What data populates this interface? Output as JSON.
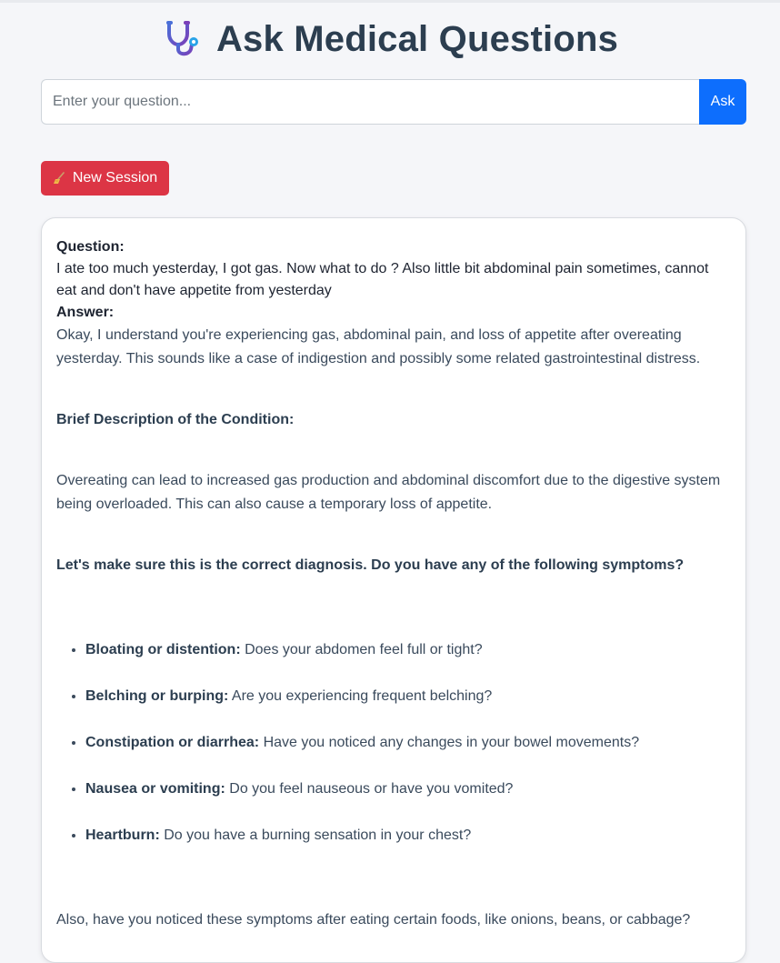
{
  "header": {
    "title": "Ask Medical Questions",
    "logo_icon": "stethoscope-icon"
  },
  "search": {
    "placeholder": "Enter your question...",
    "value": "",
    "ask_label": "Ask"
  },
  "new_session": {
    "label": "New Session",
    "icon": "broom-icon"
  },
  "conversation": {
    "question_label": "Question:",
    "question_text": "I ate too much yesterday, I got gas. Now what to do ? Also little bit abdominal pain sometimes, cannot eat and don't have appetite from yesterday",
    "answer_label": "Answer:",
    "intro": "Okay, I understand you're experiencing gas, abdominal pain, and loss of appetite after overeating yesterday. This sounds like a case of indigestion and possibly some related gastrointestinal distress.",
    "description_heading": "Brief Description of the Condition:",
    "description_text": "Overeating can lead to increased gas production and abdominal discomfort due to the digestive system being overloaded. This can also cause a temporary loss of appetite.",
    "diagnosis_prompt": "Let's make sure this is the correct diagnosis. Do you have any of the following symptoms?",
    "symptoms": [
      {
        "term": "Bloating or distention:",
        "text": " Does your abdomen feel full or tight?"
      },
      {
        "term": "Belching or burping:",
        "text": " Are you experiencing frequent belching?"
      },
      {
        "term": "Constipation or diarrhea:",
        "text": " Have you noticed any changes in your bowel movements?"
      },
      {
        "term": "Nausea or vomiting:",
        "text": " Do you feel nauseous or have you vomited?"
      },
      {
        "term": "Heartburn:",
        "text": " Do you have a burning sensation in your chest?"
      }
    ],
    "followup": "Also, have you noticed these symptoms after eating certain foods, like onions, beans, or cabbage?"
  },
  "colors": {
    "ask_button": "#0d6efd",
    "new_session_button": "#dc3545",
    "title_text": "#2c3e50"
  }
}
